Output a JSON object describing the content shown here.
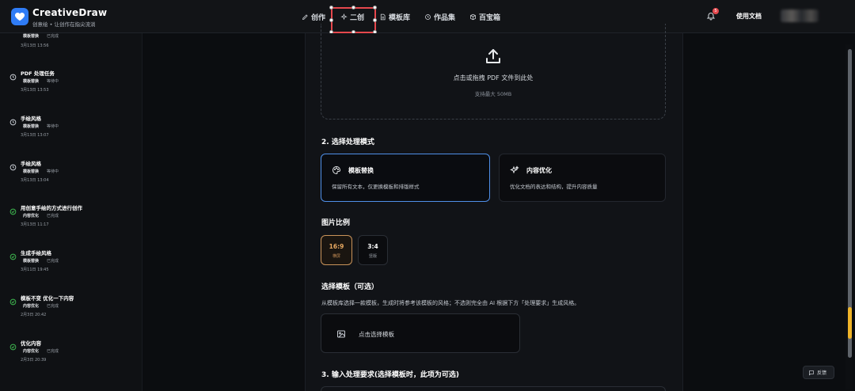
{
  "brand": {
    "name": "CreativeDraw",
    "tagline": "创意绘 • 让创作在指尖流淌"
  },
  "nav": {
    "items": [
      {
        "label": "创作",
        "icon": "brush-icon"
      },
      {
        "label": "二创",
        "icon": "sparkle-icon"
      },
      {
        "label": "模板库",
        "icon": "document-icon"
      },
      {
        "label": "作品集",
        "icon": "history-icon"
      },
      {
        "label": "百宝箱",
        "icon": "box-icon"
      }
    ],
    "notification_count": "5",
    "docs_label": "使用文档"
  },
  "sidebar": {
    "history": [
      {
        "title": "",
        "tag": "模板替换",
        "status": "已完成",
        "time": "3月13日 13:56",
        "state": "done"
      },
      {
        "title": "PDF 处理任务",
        "tag": "模板替换",
        "status": "等待中",
        "time": "3月13日 13:53",
        "state": "pending"
      },
      {
        "title": "手绘风格",
        "tag": "模板替换",
        "status": "等待中",
        "time": "3月13日 13:07",
        "state": "pending"
      },
      {
        "title": "手绘风格",
        "tag": "模板替换",
        "status": "等待中",
        "time": "3月13日 13:04",
        "state": "pending"
      },
      {
        "title": "用创意手绘的方式进行创作",
        "tag": "内容优化",
        "status": "已完成",
        "time": "3月13日 11:17",
        "state": "done"
      },
      {
        "title": "生成手绘风格",
        "tag": "模板替换",
        "status": "已完成",
        "time": "3月11日 19:45",
        "state": "done"
      },
      {
        "title": "模板不变 优化一下内容",
        "tag": "内容优化",
        "status": "已完成",
        "time": "2月3日 20:42",
        "state": "done"
      },
      {
        "title": "优化内容",
        "tag": "内容优化",
        "status": "已完成",
        "time": "2月3日 20:39",
        "state": "done"
      }
    ]
  },
  "upload": {
    "text": "点击或拖拽 PDF 文件到此处",
    "sub": "支持最大 50MB"
  },
  "mode": {
    "title": "2. 选择处理模式",
    "options": [
      {
        "title": "模板替换",
        "desc": "保留所有文本，仅更换模板和排版样式",
        "icon": "palette-icon",
        "active": true
      },
      {
        "title": "内容优化",
        "desc": "优化文档的表达和结构，提升内容质量",
        "icon": "sparkle-icon",
        "active": false
      }
    ]
  },
  "ratio": {
    "title": "图片比例",
    "options": [
      {
        "value": "16:9",
        "label": "横屏",
        "active": true
      },
      {
        "value": "3:4",
        "label": "竖版",
        "active": false
      }
    ]
  },
  "template": {
    "title": "选择模板（可选）",
    "desc": "从模板库选择一款模板，生成时将参考该模板的风格；不选则完全由 AI 根据下方「处理要求」生成风格。",
    "picker_label": "点击选择模板"
  },
  "requirements": {
    "title": "3. 输入处理要求(选择模板时，此项为可选)"
  },
  "feedback_label": "反馈",
  "colors": {
    "accent_blue": "#4f8fe8",
    "accent_orange": "#e8a961",
    "selection_red": "#e5484d"
  }
}
